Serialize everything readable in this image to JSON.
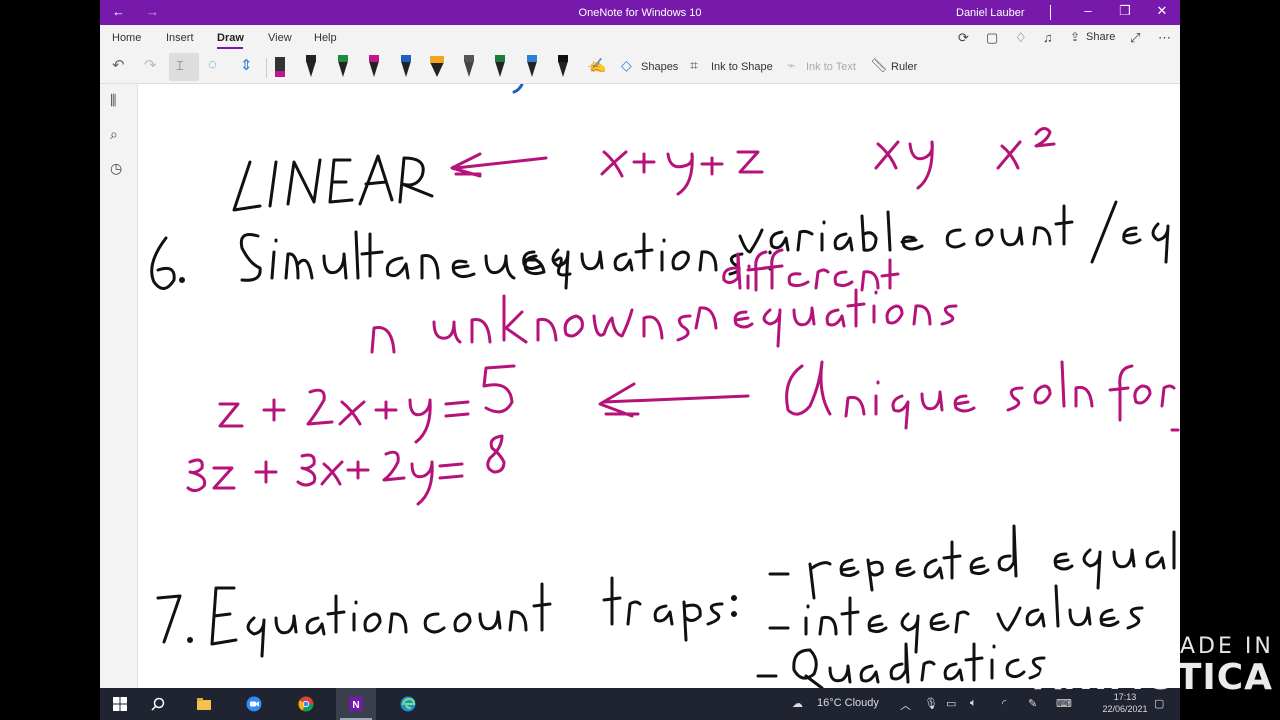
{
  "window": {
    "title": "OneNote for Windows 10",
    "user": "Daniel Lauber",
    "back_icon": "back-arrow-icon",
    "forward_icon": "forward-arrow-icon",
    "accent": "#7719aa"
  },
  "ribbon": {
    "tabs": [
      {
        "label": "Home",
        "active": false
      },
      {
        "label": "Insert",
        "active": false
      },
      {
        "label": "Draw",
        "active": true
      },
      {
        "label": "View",
        "active": false
      },
      {
        "label": "Help",
        "active": false
      }
    ],
    "share_label": "Share"
  },
  "toolbar": {
    "pen_colors": [
      "#222222",
      "#1e8a3a",
      "#c0188c",
      "#1f5fbf",
      "#f3a51b",
      "#555555",
      "#1d7b3a",
      "#2d7fd1",
      "#111111"
    ],
    "shapes_label": "Shapes",
    "ink_to_shape_label": "Ink to Shape",
    "ink_to_text_label": "Ink to Text",
    "ruler_label": "Ruler"
  },
  "taskbar": {
    "weather": "16°C  Cloudy",
    "time": "17:13",
    "date": "22/06/2021"
  },
  "watermark": {
    "line1": "MADE IN",
    "line2": "ANIMOTICA"
  },
  "ink_colors": {
    "black": "#111111",
    "magenta": "#b5127a",
    "blue": "#1f5fbf"
  }
}
